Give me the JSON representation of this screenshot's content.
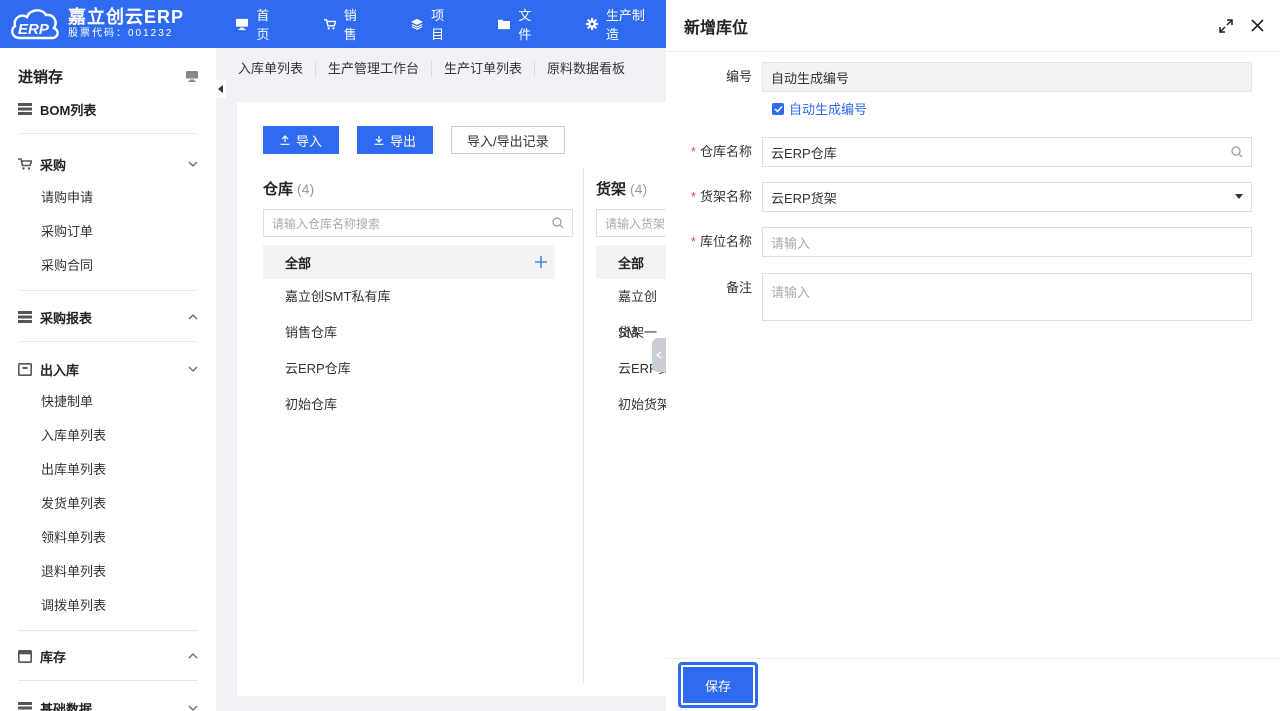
{
  "brand": {
    "title": "嘉立创云ERP",
    "subtitle": "股票代码：001232",
    "logo_text": "ERP"
  },
  "nav": [
    {
      "label": "首页",
      "icon": "monitor-icon"
    },
    {
      "label": "销售",
      "icon": "cart-icon"
    },
    {
      "label": "项目",
      "icon": "layers-icon"
    },
    {
      "label": "文件",
      "icon": "folder-icon"
    },
    {
      "label": "生产制造",
      "icon": "gear-icon"
    }
  ],
  "sidebar": {
    "title": "进销存",
    "bom": "BOM列表",
    "purchase": {
      "label": "采购",
      "items": [
        "请购申请",
        "采购订单",
        "采购合同"
      ]
    },
    "purchase_report": {
      "label": "采购报表"
    },
    "inout": {
      "label": "出入库",
      "items": [
        "快捷制单",
        "入库单列表",
        "出库单列表",
        "发货单列表",
        "领料单列表",
        "退料单列表",
        "调拨单列表"
      ]
    },
    "inventory": {
      "label": "库存"
    },
    "basic": {
      "label": "基础数据"
    }
  },
  "tabs": [
    "入库单列表",
    "生产管理工作台",
    "生产订单列表",
    "原料数据看板"
  ],
  "toolbar": {
    "import": "导入",
    "export": "导出",
    "records": "导入/导出记录"
  },
  "warehouse": {
    "title": "仓库",
    "count": "(4)",
    "search_placeholder": "请输入仓库名称搜索",
    "all": "全部",
    "items": [
      "嘉立创SMT私有库",
      "销售仓库",
      "云ERP仓库",
      "初始仓库"
    ]
  },
  "shelf": {
    "title": "货架",
    "count": "(4)",
    "search_placeholder": "请输入货架",
    "all": "全部",
    "items": [
      "嘉立创SM",
      "货架一",
      "云ERP货",
      "初始货架"
    ]
  },
  "drawer": {
    "title": "新增库位",
    "fields": {
      "code": {
        "label": "编号",
        "value": "自动生成编号"
      },
      "auto_code": {
        "label": "自动生成编号"
      },
      "warehouse": {
        "label": "仓库名称",
        "value": "云ERP仓库"
      },
      "shelf": {
        "label": "货架名称",
        "value": "云ERP货架"
      },
      "location": {
        "label": "库位名称",
        "placeholder": "请输入"
      },
      "remark": {
        "label": "备注",
        "placeholder": "请输入"
      }
    },
    "save": "保存"
  },
  "colors": {
    "primary": "#2f6bf0",
    "required": "#f53f3f"
  }
}
